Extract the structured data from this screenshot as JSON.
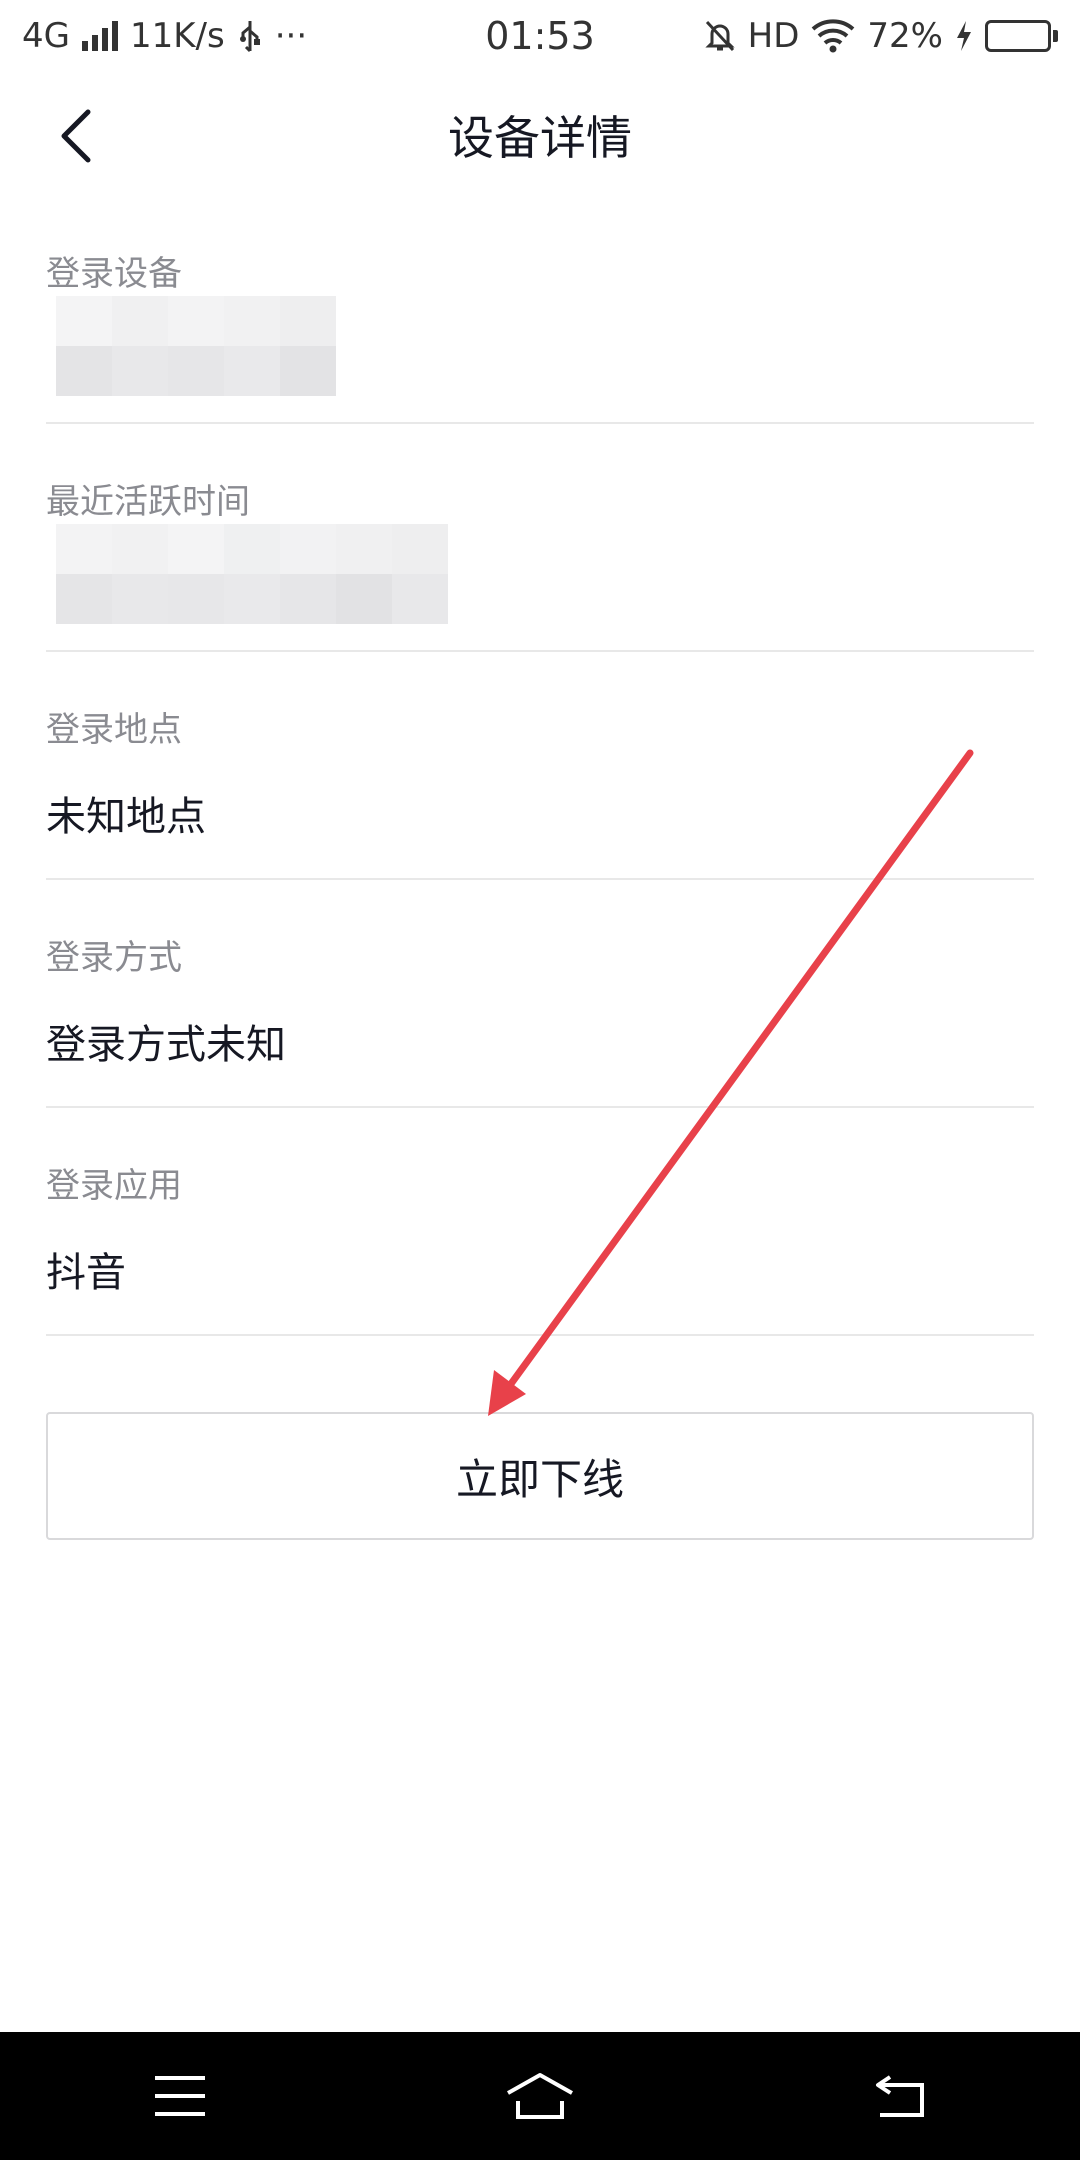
{
  "status_bar": {
    "network": "4G",
    "speed": "11K/s",
    "usb_icon": "usb-icon",
    "more": "···",
    "time": "01:53",
    "hd": "HD",
    "battery_percent": "72%",
    "battery_level": 0.72
  },
  "header": {
    "title": "设备详情",
    "back_icon": "chevron-left-icon"
  },
  "info_items": [
    {
      "label": "登录设备",
      "value": ""
    },
    {
      "label": "最近活跃时间",
      "value": ""
    },
    {
      "label": "登录地点",
      "value": "未知地点"
    },
    {
      "label": "登录方式",
      "value": "登录方式未知"
    },
    {
      "label": "登录应用",
      "value": "抖音"
    }
  ],
  "actions": {
    "offline_label": "立即下线"
  },
  "annotation": {
    "arrow_color": "#e8414a"
  },
  "colors": {
    "label_gray": "#8a8b91",
    "divider": "#e8e8e8",
    "nav_background": "#000000"
  }
}
